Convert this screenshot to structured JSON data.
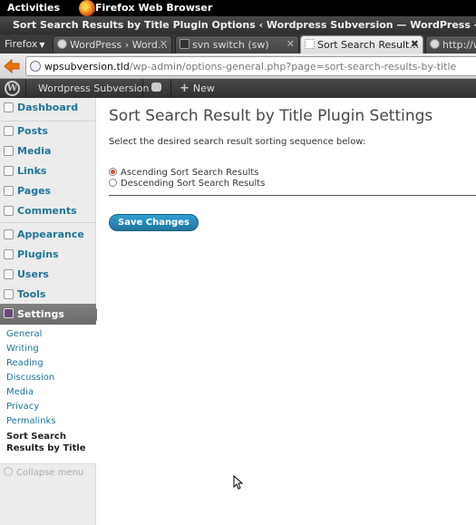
{
  "gnome": {
    "activities": "Activities",
    "app_name": "Firefox Web Browser"
  },
  "window": {
    "title": "Sort Search Results by Title Plugin Options ‹ Wordpress Subversion — WordPress - Mozilla Firefox"
  },
  "browser": {
    "menu_label": "Firefox",
    "tabs": [
      {
        "label": "WordPress › Word…",
        "active": false
      },
      {
        "label": "svn switch (sw)",
        "active": false
      },
      {
        "label": "Sort Search Result…",
        "active": true
      },
      {
        "label": "http://www.",
        "active": false
      }
    ],
    "url_domain": "wpsubversion.tld",
    "url_path": "/wp-admin/options-general.php?page=sort-search-results-by-title"
  },
  "wp_admin_bar": {
    "site_name": "Wordpress Subversion",
    "new_label": "New"
  },
  "sidebar": {
    "items": [
      {
        "label": "Dashboard",
        "icon": "dashboard-icon"
      },
      {
        "label": "Posts",
        "icon": "pin-icon"
      },
      {
        "label": "Media",
        "icon": "media-icon"
      },
      {
        "label": "Links",
        "icon": "link-icon"
      },
      {
        "label": "Pages",
        "icon": "pages-icon"
      },
      {
        "label": "Comments",
        "icon": "comments-icon"
      },
      {
        "label": "Appearance",
        "icon": "appearance-icon"
      },
      {
        "label": "Plugins",
        "icon": "plugin-icon"
      },
      {
        "label": "Users",
        "icon": "users-icon"
      },
      {
        "label": "Tools",
        "icon": "tools-icon"
      },
      {
        "label": "Settings",
        "icon": "settings-icon"
      }
    ],
    "submenu": [
      "General",
      "Writing",
      "Reading",
      "Discussion",
      "Media",
      "Privacy",
      "Permalinks"
    ],
    "submenu_current_line1": "Sort Search",
    "submenu_current_line2": "Results by Title",
    "collapse": "Collapse menu"
  },
  "main": {
    "title": "Sort Search Result by Title Plugin Settings",
    "description": "Select the desired search result sorting sequence below:",
    "options": [
      {
        "label": "Ascending Sort Search Results",
        "checked": true
      },
      {
        "label": "Descending Sort Search Results",
        "checked": false
      }
    ],
    "save_label": "Save Changes"
  },
  "colors": {
    "link": "#21759b",
    "accent": "#d54e21",
    "button": "#21759b"
  }
}
